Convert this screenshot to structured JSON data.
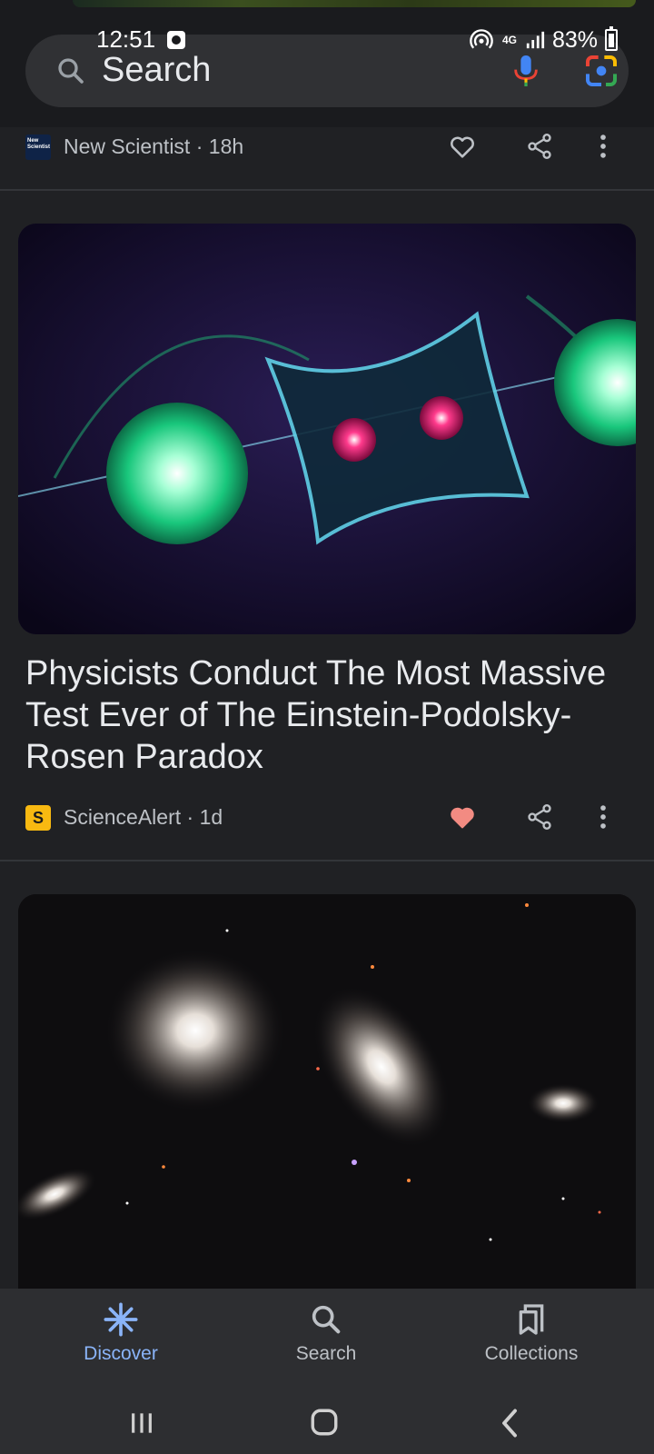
{
  "status_bar": {
    "time": "12:51",
    "network": "4G",
    "battery": "83%"
  },
  "search_bar": {
    "placeholder": "Search"
  },
  "articles": [
    {
      "publisher": "New Scientist",
      "logo_text": "New Scientist",
      "age": "18h",
      "liked": false
    },
    {
      "headline": "Physicists Conduct The Most Massive Test Ever of The Einstein-Podolsky-Rosen Paradox",
      "publisher": "ScienceAlert",
      "logo_text": "S",
      "age": "1d",
      "liked": true
    }
  ],
  "bottom_nav": {
    "items": [
      {
        "label": "Discover",
        "active": true
      },
      {
        "label": "Search",
        "active": false
      },
      {
        "label": "Collections",
        "active": false
      }
    ]
  },
  "colors": {
    "background": "#202124",
    "accent": "#8ab4f8",
    "liked_heart": "#f28b82"
  }
}
